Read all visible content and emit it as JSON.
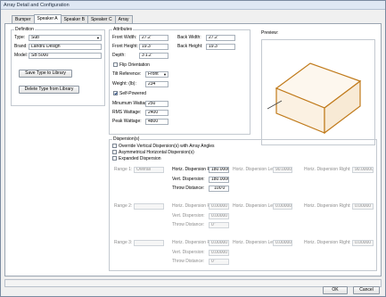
{
  "window": {
    "title": "Array Detail and Configuration"
  },
  "tabs": [
    "Bumper",
    "Speaker A",
    "Speaker B",
    "Speaker C",
    "Array"
  ],
  "definition": {
    "label": "Definition",
    "type_label": "Type:",
    "type_value": "Sub",
    "brand_label": "Brand:",
    "brand_value": "Landru Design",
    "model_label": "Model:",
    "model_value": "SB 5000",
    "save_button": "Save Type to Library",
    "delete_button": "Delete Type from Library"
  },
  "attributes": {
    "label": "Attributes",
    "front_width_label": "Front Width:",
    "front_width": "27.2\"",
    "back_width_label": "Back Width:",
    "back_width": "27.2\"",
    "front_height_label": "Front Height:",
    "front_height": "19.3\"",
    "back_height_label": "Back Height:",
    "back_height": "19.3\"",
    "depth_label": "Depth:",
    "depth": "3'1.2\"",
    "flip_label": "Flip Orientation",
    "tilt_label": "Tilt Reference:",
    "tilt_value": "Front",
    "weight_label": "Weight: (lb):",
    "weight": "234",
    "self_powered_label": "Self-Powered",
    "min_wattage_label": "Minumum Wattage:",
    "min_wattage": "250",
    "rms_wattage_label": "RMS Wattage:",
    "rms_wattage": "2400",
    "peak_wattage_label": "Peak Wattage:",
    "peak_wattage": "4800"
  },
  "preview": {
    "label": "Preview:"
  },
  "dispersion": {
    "label": "Dispersion(s)",
    "override_label": "Override Vertical Dispersion(s) with Array Angles",
    "asym_label": "Asymmetrical Horizontal Dispersion(s)",
    "expanded_label": "Expanded Dispersion",
    "range1_label": "Range 1:",
    "range1_value": "Overall",
    "range2_label": "Range 2:",
    "range3_label": "Range 3:",
    "horiz_full_label": "Horiz. Dispersion Full:",
    "horiz_left_label": "Horiz. Dispersion Left:",
    "horiz_right_label": "Horiz. Dispersion Right:",
    "vert_label": "Vert. Dispersion:",
    "throw_label": "Throw Distance:",
    "r1_horiz_full": "180.0000",
    "r1_horiz_left": "90.00000",
    "r1_horiz_right": "90.00000",
    "r1_vert": "180.0000",
    "r1_throw": "100'0\"",
    "r2_horiz_full": "0.00000",
    "r2_horiz_left": "0.00000",
    "r2_horiz_right": "0.00000",
    "r2_vert": "0.00000",
    "r2_throw": "0\"",
    "r3_horiz_full": "0.00000",
    "r3_horiz_left": "0.00000",
    "r3_horiz_right": "0.00000",
    "r3_vert": "0.00000",
    "r3_throw": "0\""
  },
  "footer": {
    "ok": "OK",
    "cancel": "Cancel"
  },
  "colors": {
    "box_edge": "#c07a1a",
    "accent": "#1a3f7a"
  }
}
